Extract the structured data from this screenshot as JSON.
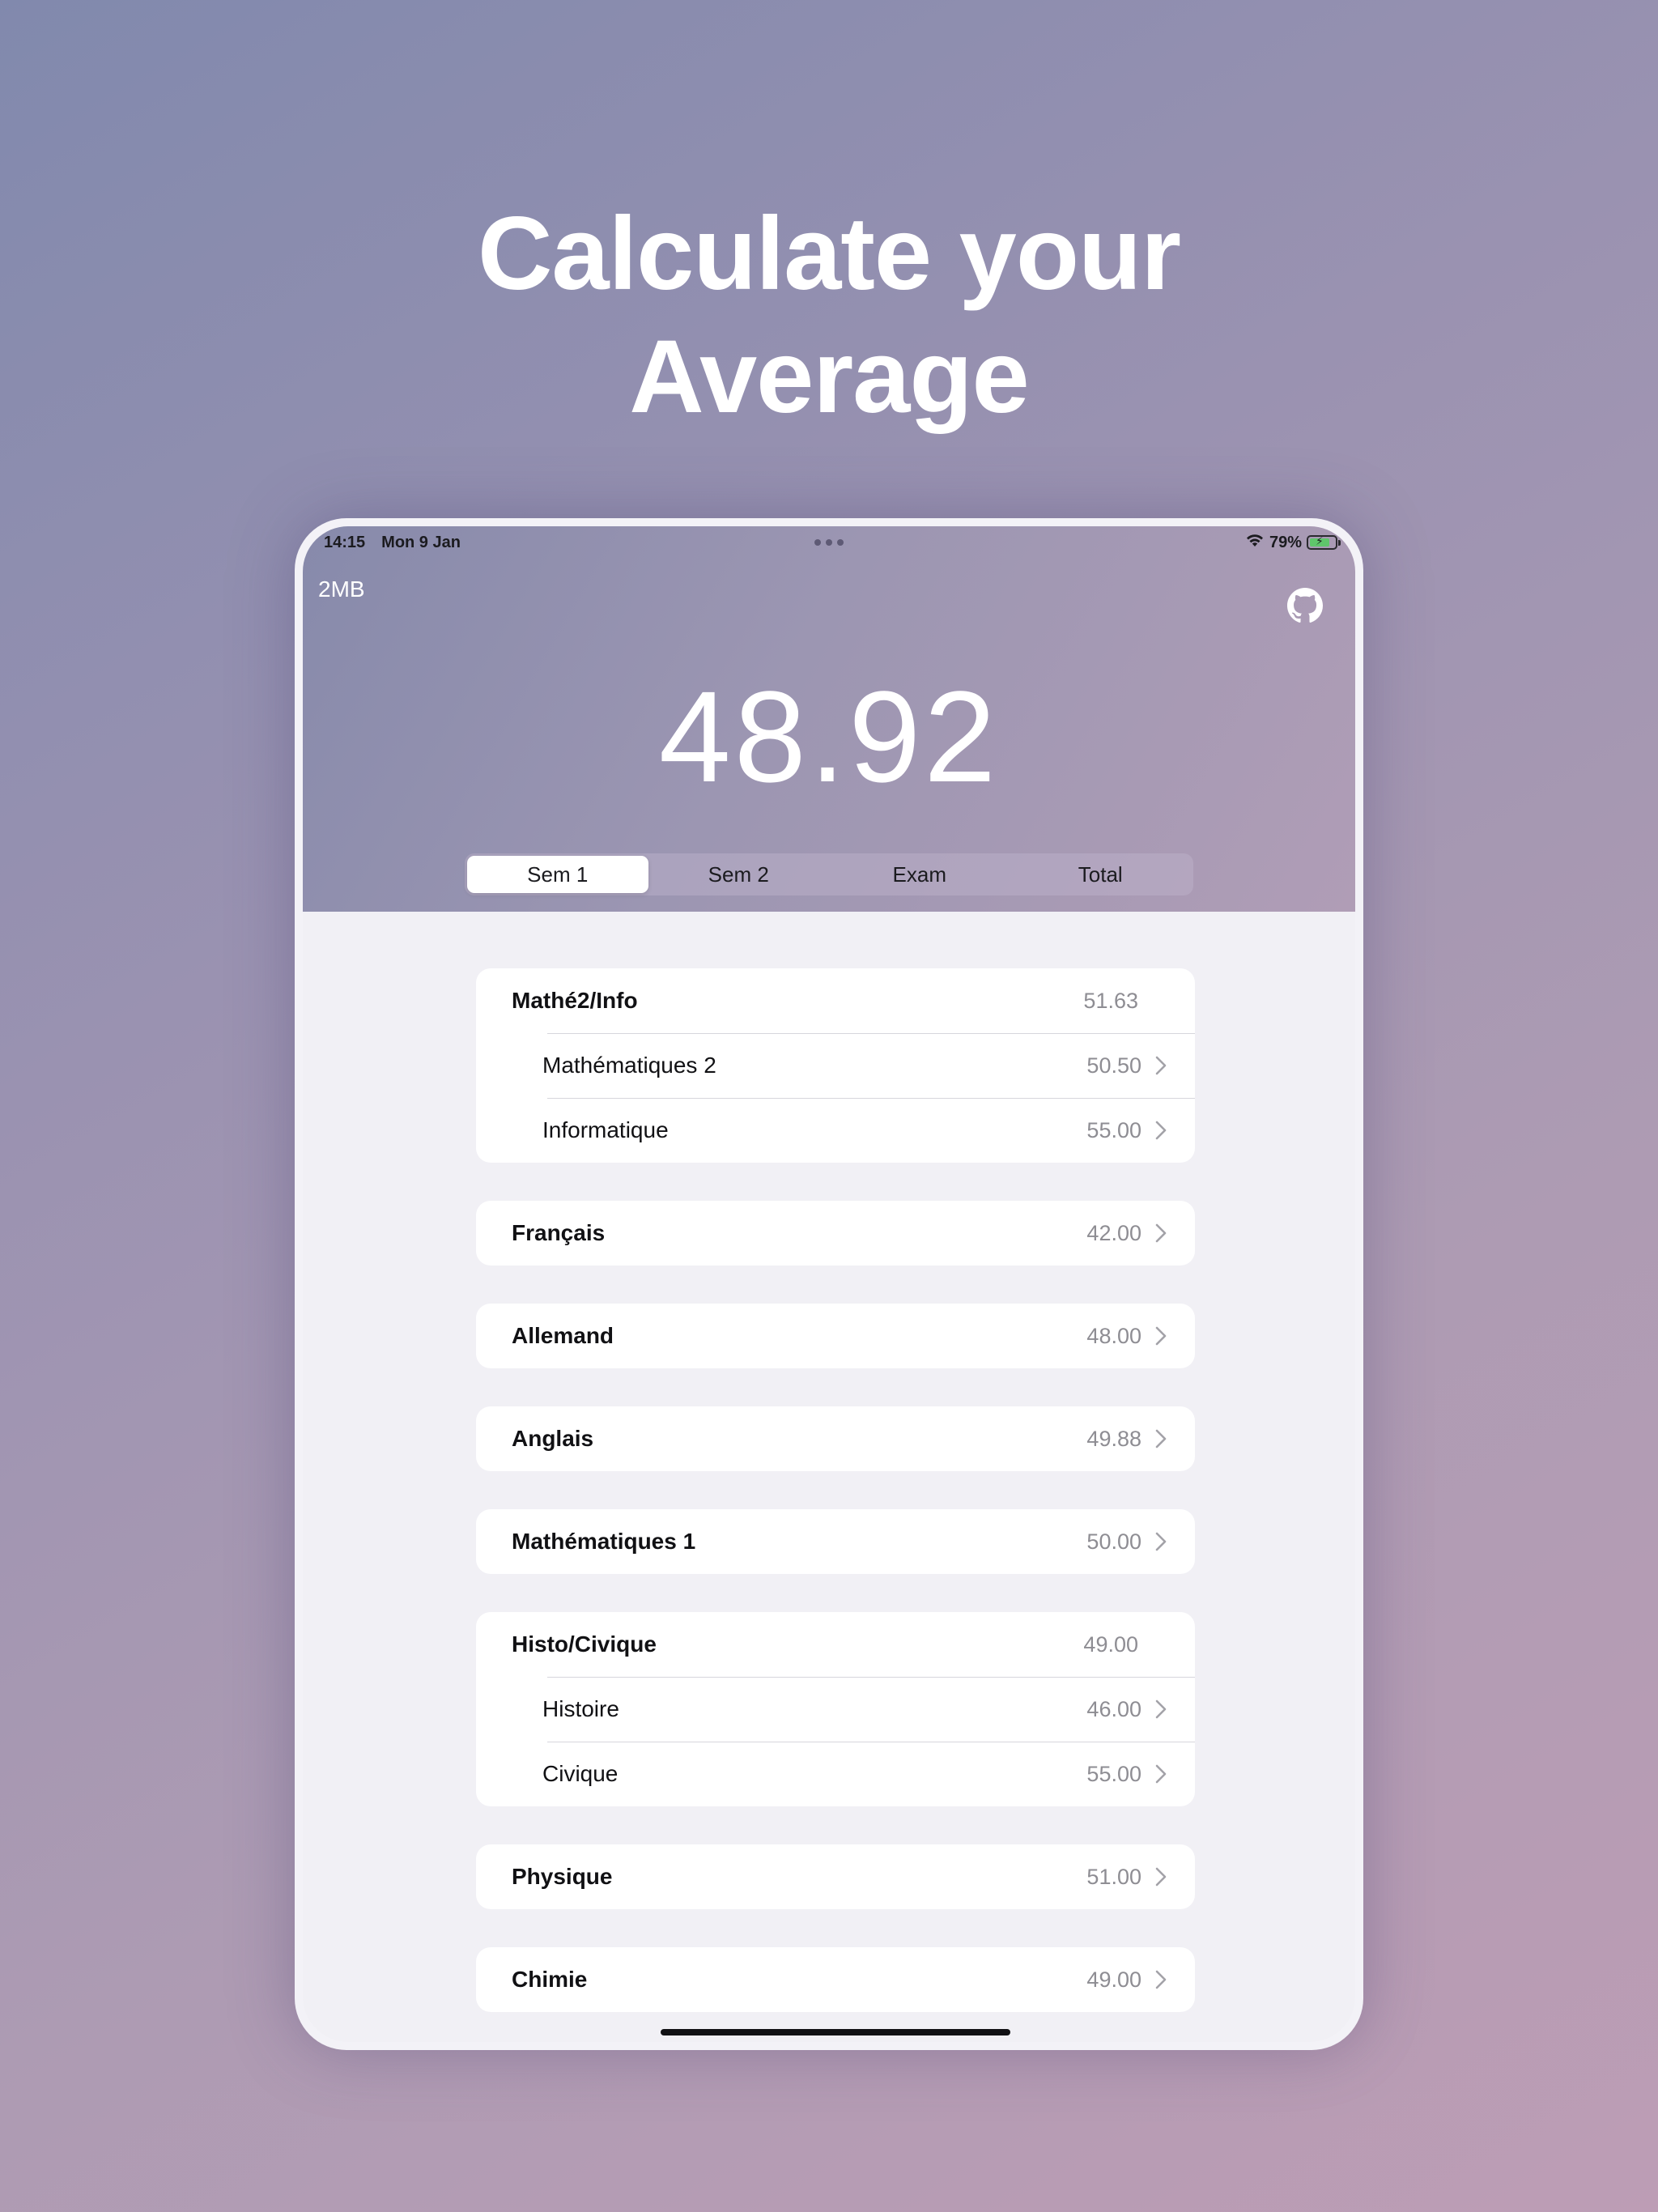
{
  "headline": {
    "line1": "Calculate your",
    "line2": "Average"
  },
  "status_bar": {
    "time": "14:15",
    "date": "Mon 9 Jan",
    "battery": "79%",
    "battery_level": 0.79
  },
  "app": {
    "label": "2MB",
    "average": "48.92"
  },
  "tabs": [
    {
      "label": "Sem 1",
      "active": true
    },
    {
      "label": "Sem 2",
      "active": false
    },
    {
      "label": "Exam",
      "active": false
    },
    {
      "label": "Total",
      "active": false
    }
  ],
  "groups": [
    {
      "name": "Mathé2/Info",
      "value": "51.63",
      "children": [
        {
          "name": "Mathématiques 2",
          "value": "50.50"
        },
        {
          "name": "Informatique",
          "value": "55.00"
        }
      ]
    },
    {
      "name": "Français",
      "value": "42.00"
    },
    {
      "name": "Allemand",
      "value": "48.00"
    },
    {
      "name": "Anglais",
      "value": "49.88"
    },
    {
      "name": "Mathématiques 1",
      "value": "50.00"
    },
    {
      "name": "Histo/Civique",
      "value": "49.00",
      "children": [
        {
          "name": "Histoire",
          "value": "46.00"
        },
        {
          "name": "Civique",
          "value": "55.00"
        }
      ]
    },
    {
      "name": "Physique",
      "value": "51.00"
    },
    {
      "name": "Chimie",
      "value": "49.00"
    }
  ],
  "icons": {
    "github": "github-icon",
    "chevron": "chevron-right-icon",
    "wifi": "wifi-icon",
    "battery": "battery-icon"
  }
}
